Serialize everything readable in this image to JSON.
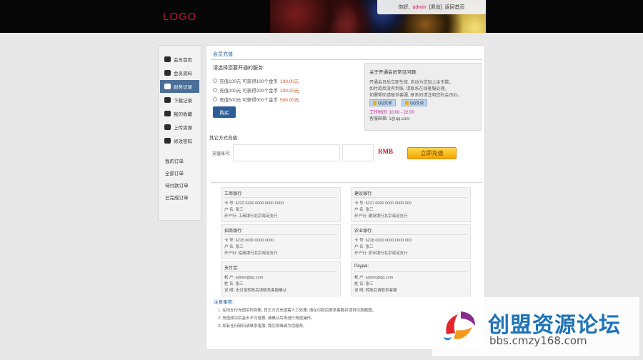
{
  "header": {
    "logo": "LOGO",
    "welcome": "你好,",
    "username": "admin",
    "logout": "[退出]",
    "home_link": "返回首页"
  },
  "sidebar": {
    "items": [
      {
        "label": "会员首页",
        "icon": "home-icon"
      },
      {
        "label": "会员资料",
        "icon": "user-icon"
      },
      {
        "label": "财务记录",
        "icon": "money-icon",
        "active": true
      },
      {
        "label": "下载记录",
        "icon": "download-icon"
      },
      {
        "label": "我的收藏",
        "icon": "mail-icon"
      },
      {
        "label": "上传资源",
        "icon": "mail-icon"
      },
      {
        "label": "修改密码",
        "icon": "mail-icon"
      }
    ],
    "section_title": "我的订单",
    "section_items": [
      "全部订单",
      "待付款订单",
      "已完成订单"
    ]
  },
  "main": {
    "title": "会员充值",
    "offer": {
      "title": "请选择您要开通的服务:",
      "plans": [
        {
          "text": "充值100元 可获得100个金币 ",
          "price": "100.00元"
        },
        {
          "text": "充值200元 可获得200个金币 ",
          "price": "200.00元"
        },
        {
          "text": "充值500元 可获得500个金币 ",
          "price": "500.00元"
        }
      ],
      "buy_label": "购买"
    },
    "info": {
      "title": "关于开通会员常见问题:",
      "lines": [
        "开通会员后立即生效, 自动为您加上金币数。",
        "如付款后没有到账, 请联系在线客服处理。",
        "如需帮助请联系客服, 联系时请注明您的会员ID。"
      ],
      "qq_buttons": [
        "QQ交谈",
        "QQ交谈"
      ],
      "time": "工作时间: 10:00 - 22:00",
      "email": "客服邮箱: 1@qq.com"
    },
    "member_label": "其它方式充值:",
    "account_label": "充值账号:",
    "account_placeholder": "",
    "amount": "RMB",
    "pay_label": "立即充值",
    "banks": [
      {
        "title": "工商银行:",
        "lines": [
          "卡   号: 6222 0200 0000 0000 0000",
          "户   名: 张三",
          "开户行: 工商银行北京海淀支行"
        ]
      },
      {
        "title": "建设银行:",
        "lines": [
          "卡   号: 6227 0000 0000 0000 000",
          "户   名: 张三",
          "开户行: 建设银行北京海淀支行"
        ]
      },
      {
        "title": "招商银行:",
        "lines": [
          "卡   号: 6225 0000 0000 0000",
          "户   名: 张三",
          "开户行: 招商银行北京海淀支行"
        ]
      },
      {
        "title": "农业银行:",
        "lines": [
          "卡   号: 6228 0000 0000 0000 000",
          "户   名: 张三",
          "开户行: 农业银行北京海淀支行"
        ]
      },
      {
        "title": "支付宝:",
        "lines": [
          "帐   户: admin@qq.com",
          "姓   名: 张三",
          "说   明: 支付宝转账后请联系客服确认"
        ]
      },
      {
        "title": "Paypal:",
        "lines": [
          "帐   户: admin@qq.com",
          "姓   名: 张三",
          "说   明: 转账后请联系客服"
        ]
      }
    ],
    "notes": {
      "title": "注意事项:",
      "lines": [
        "1. 在线支付充值实时到账, 其它方式充值需人工处理, 请在付款后联系客服并提供付款截图。",
        "2. 充值成功后金币不可退换, 请确认后再进行充值操作。",
        "3. 如有任何疑问请联系客服, 我们将竭诚为您服务。"
      ]
    }
  },
  "watermark": {
    "cn": "创盟资源论坛",
    "url": "bbs.cmzy168.com"
  }
}
